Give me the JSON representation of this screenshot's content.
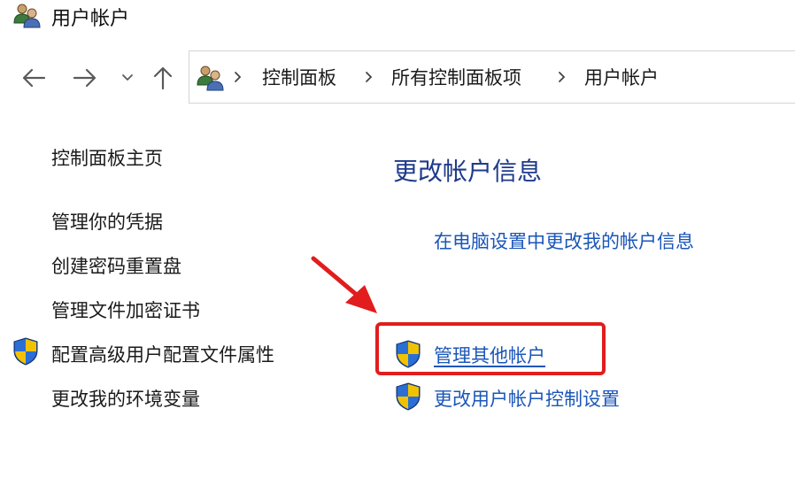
{
  "window": {
    "title": "用户帐户",
    "icon": "users-icon"
  },
  "nav": {
    "back_icon": "back-arrow-icon",
    "forward_icon": "forward-arrow-icon",
    "recent_icon": "chevron-down-icon",
    "up_icon": "up-arrow-icon"
  },
  "address": {
    "icon": "users-icon",
    "crumbs": [
      "控制面板",
      "所有控制面板项",
      "用户帐户"
    ]
  },
  "sidebar": {
    "items": [
      {
        "label": "控制面板主页",
        "icon": null
      },
      {
        "label": "管理你的凭据",
        "icon": null
      },
      {
        "label": "创建密码重置盘",
        "icon": null
      },
      {
        "label": "管理文件加密证书",
        "icon": null
      },
      {
        "label": "配置高级用户配置文件属性",
        "icon": "uac-shield-icon"
      },
      {
        "label": "更改我的环境变量",
        "icon": null
      }
    ]
  },
  "main": {
    "heading": "更改帐户信息",
    "links": [
      {
        "label": "在电脑设置中更改我的帐户信息",
        "icon": null
      },
      {
        "label": "管理其他帐户",
        "icon": "uac-shield-icon",
        "highlighted": true
      },
      {
        "label": "更改用户帐户控制设置",
        "icon": "uac-shield-icon"
      }
    ]
  },
  "annotation": {
    "highlight_color": "#e11d1d"
  },
  "colors": {
    "link": "#1a56b8",
    "heading": "#1e3a8a",
    "text": "#1a1a1a"
  }
}
